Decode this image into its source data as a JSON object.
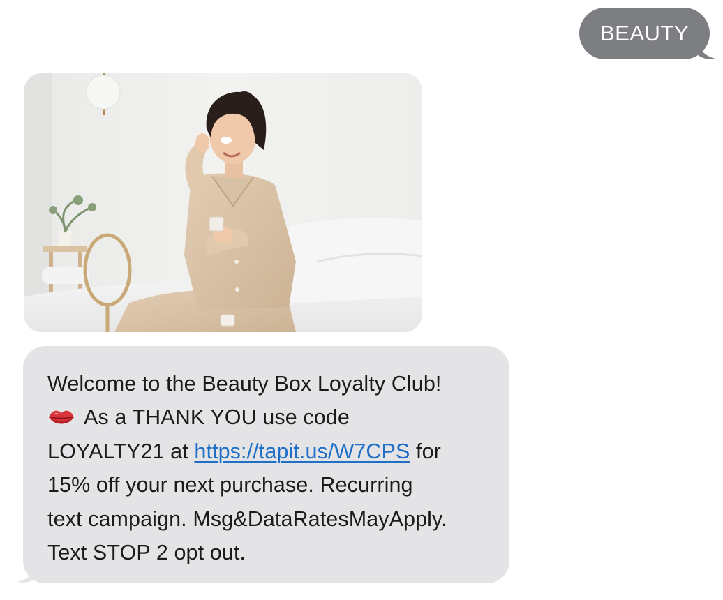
{
  "outgoing_message": {
    "text": "BEAUTY",
    "bubble_color": "#7d7e82"
  },
  "incoming_image": {
    "icon": "photo-woman-skincare-bed"
  },
  "incoming_message": {
    "bubble_color": "#e4e4e6",
    "line1": "Welcome to the Beauty Box Loyalty Club!",
    "emoji_icon": "kiss-mark-emoji",
    "line2_text": "As a THANK YOU use code",
    "line3_before_link": "LOYALTY21 at ",
    "link_text": "https://tapit.us/W7CPS",
    "line3_after_link": " for",
    "line4": "15% off your next purchase. Recurring",
    "line5": "text campaign. Msg&DataRatesMayApply.",
    "line6": "Text STOP 2 opt out.",
    "link_color": "#1f6fc6"
  }
}
